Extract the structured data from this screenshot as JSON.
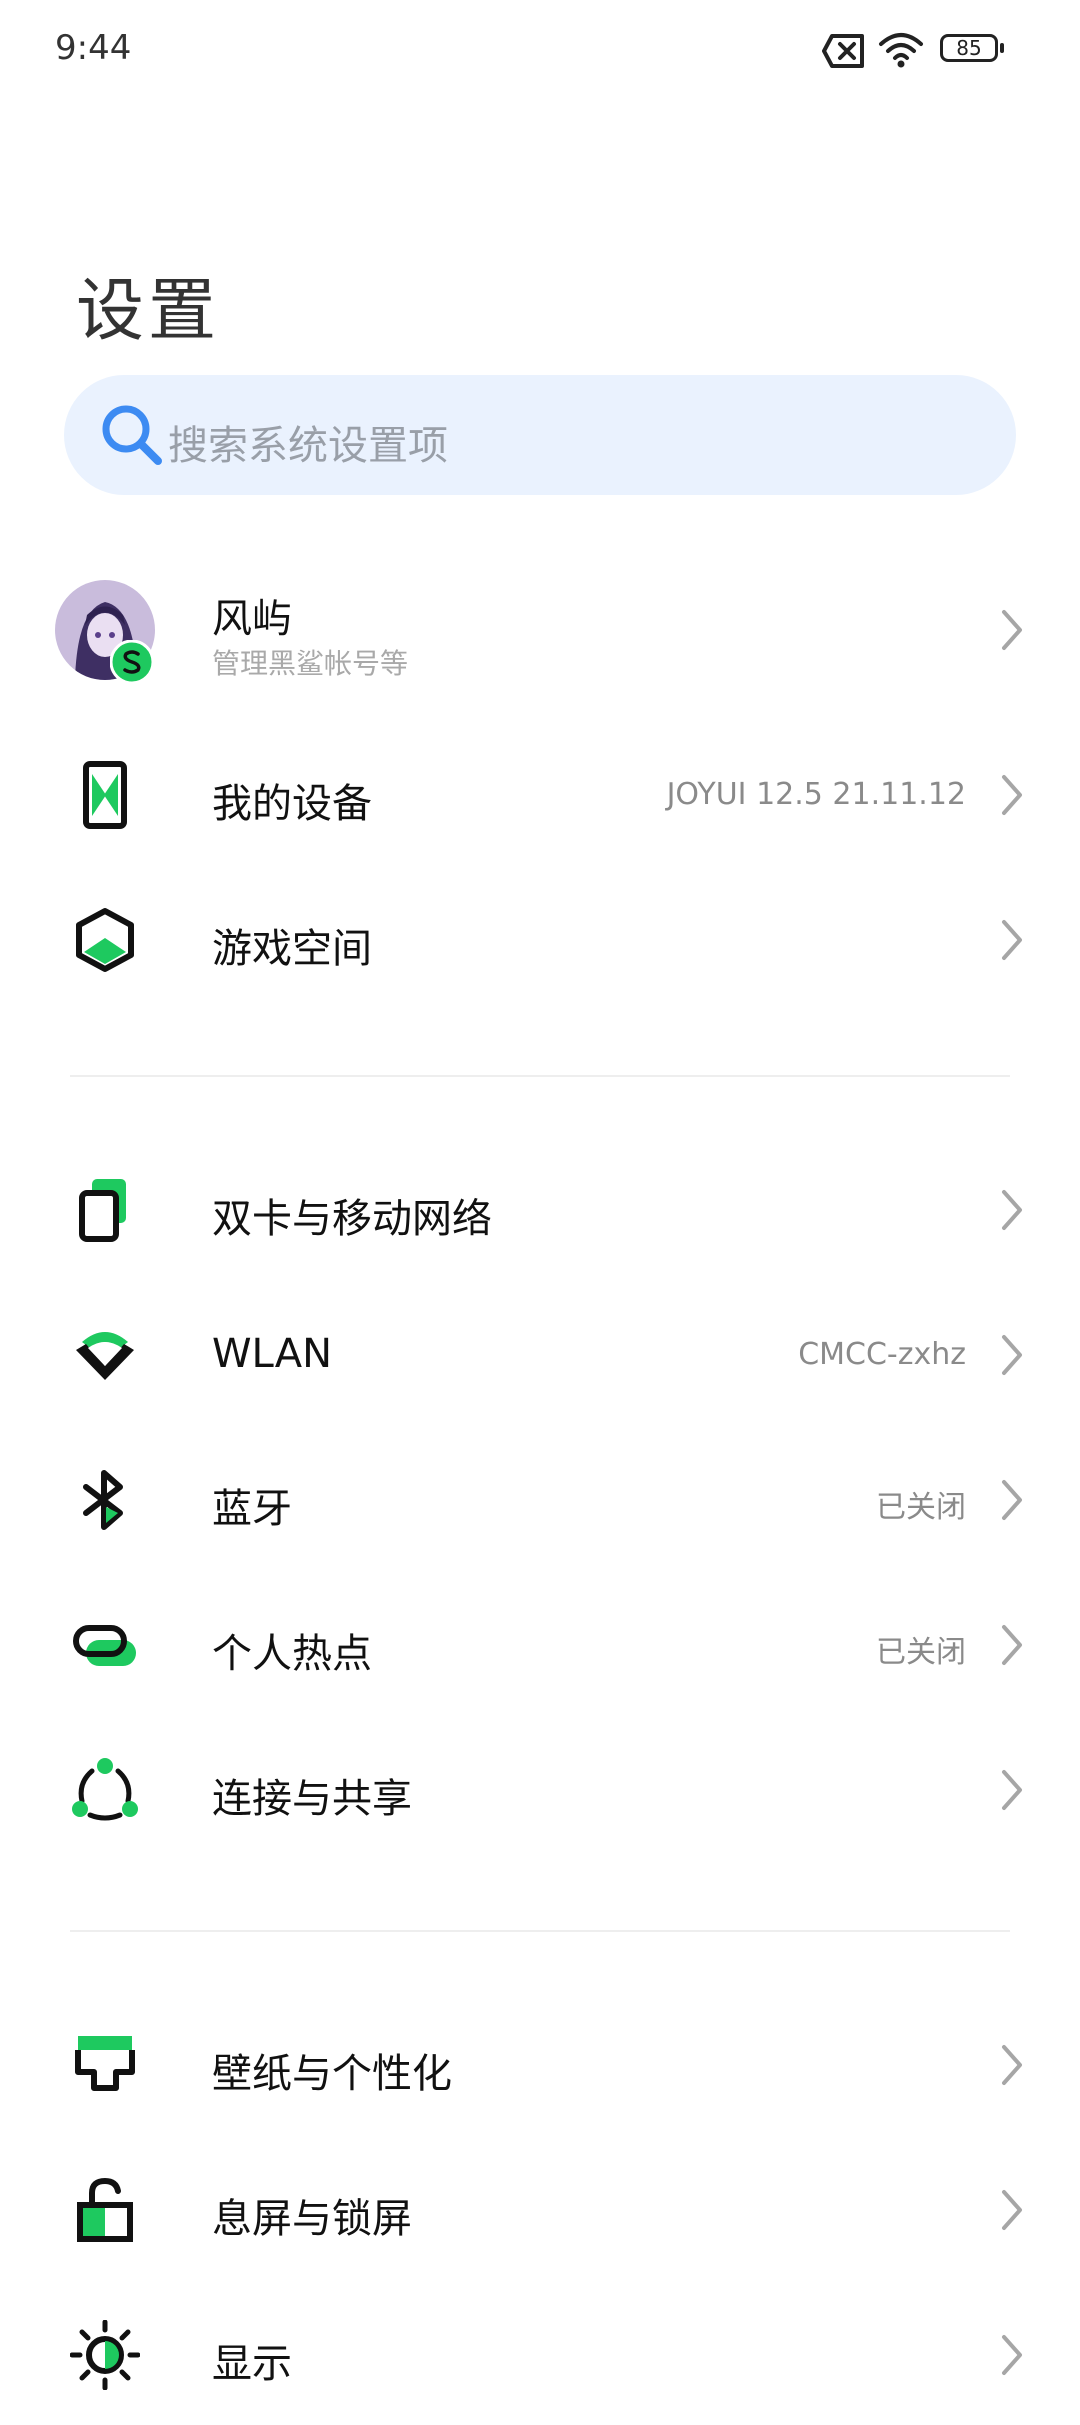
{
  "status_bar": {
    "time": "9:44",
    "battery": "85",
    "icons": [
      "sim-error-icon",
      "wifi-icon",
      "battery-icon"
    ]
  },
  "page": {
    "title": "设置"
  },
  "search": {
    "placeholder": "搜索系统设置项"
  },
  "profile": {
    "name": "风屿",
    "subtitle": "管理黑鲨帐号等"
  },
  "groups": [
    {
      "items": [
        {
          "label": "我的设备",
          "value": "JOYUI 12.5 21.11.12",
          "icon": "phone-device-icon"
        },
        {
          "label": "游戏空间",
          "value": "",
          "icon": "game-space-icon"
        }
      ]
    },
    {
      "items": [
        {
          "label": "双卡与移动网络",
          "value": "",
          "icon": "sim-card-icon"
        },
        {
          "label": "WLAN",
          "value": "CMCC-zxhz",
          "icon": "wlan-icon"
        },
        {
          "label": "蓝牙",
          "value": "已关闭",
          "icon": "bluetooth-icon"
        },
        {
          "label": "个人热点",
          "value": "已关闭",
          "icon": "hotspot-icon"
        },
        {
          "label": "连接与共享",
          "value": "",
          "icon": "share-icon"
        }
      ]
    },
    {
      "items": [
        {
          "label": "壁纸与个性化",
          "value": "",
          "icon": "wallpaper-icon"
        },
        {
          "label": "息屏与锁屏",
          "value": "",
          "icon": "lock-icon"
        },
        {
          "label": "显示",
          "value": "",
          "icon": "display-icon"
        }
      ]
    }
  ],
  "colors": {
    "accent_green": "#1ec95f",
    "search_bg": "#eaf2fe",
    "search_icon": "#3d8bf2"
  }
}
